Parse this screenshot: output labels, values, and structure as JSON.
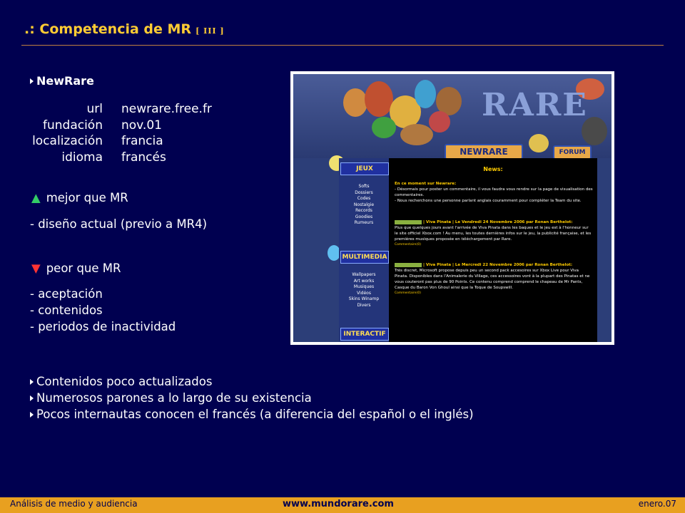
{
  "header": {
    "title": ".: Competencia de MR",
    "tag": "[ III ]"
  },
  "site": {
    "name": "NewRare",
    "info": [
      {
        "key": "url",
        "value": "newrare.free.fr"
      },
      {
        "key": "fundación",
        "value": "nov.01"
      },
      {
        "key": "localización",
        "value": "francia"
      },
      {
        "key": "idioma",
        "value": "francés"
      }
    ]
  },
  "better": {
    "icon": "triangle-up-icon",
    "heading": "mejor que MR",
    "items": [
      "- diseño actual (previo a MR4)"
    ]
  },
  "worse": {
    "icon": "triangle-down-icon",
    "heading": "peor que MR",
    "items": [
      "- aceptación",
      "- contenidos",
      "- periodos de inactividad"
    ]
  },
  "conclusions": [
    "Contenidos poco actualizados",
    "Numerosos parones a lo largo de su existencia",
    "Pocos internautas conocen el francés (a diferencia del español o el inglés)"
  ],
  "screenshot": {
    "logo": "RARE",
    "tab_newrare": "NEWRARE",
    "tab_forum": "FORUM",
    "side_jeux": "JEUX",
    "side_jeux_links": [
      "Softs",
      "Dossiers",
      "Codes",
      "Nostalgie",
      "Records",
      "Goodies",
      "Rumeurs"
    ],
    "side_multimedia": "MULTIMEDIA",
    "side_multimedia_links": [
      "Wallpapers",
      "Art works",
      "Musiques",
      "Vidéos",
      "Skins Winamp",
      "Divers"
    ],
    "side_interactif": "INTERACTIF",
    "news_title": "News:",
    "intro_heading": "En ce moment sur Newrare:",
    "intro_line1": "- Désormais pour poster un commentaire, il vous faudra vous rendre sur la page de visualisation des commentaires.",
    "intro_line2": "- Nous recherchons une personne parlant anglais couramment pour compléter la Team du site.",
    "post1_header": "| Viva Pinata | Le Vendredi 24 Novembre 2006 par Ronan Berthelot:",
    "post1_body": "Plus que quelques jours avant l'arrivée de Viva Pinata dans les baques et le jeu est à l'honneur sur le site officiel Xbox.com ! Au menu, les toutes dernières infos sur le jeu, la publicité française, et les premières musiques proposée en téléchargement par Rare.",
    "post1_comments": "Commentaire(0)",
    "post2_header": "| Viva Pinata | Le Mercredi 22 Novembre 2006 par Ronan Berthelot:",
    "post2_body": "Très discret, Microsoft propose depuis peu un second pack accesoires sur Xbox Live pour Viva Pinata. Disponibles dans l'Animalerie du Village, ces accessoires vont à la plupart des Pinatas et ne vous couteront pas plus de 90 Points. Ce contenu comprend comprend le chapeau de Mr Pants, Casque du Baron Von Ghoul ainsi que la Toque de Soupswill.",
    "post2_comments": "Commentaire(0)"
  },
  "footer": {
    "left": "Análisis de medio y audiencia",
    "center": "www.mundorare.com",
    "right": "enero.07"
  }
}
